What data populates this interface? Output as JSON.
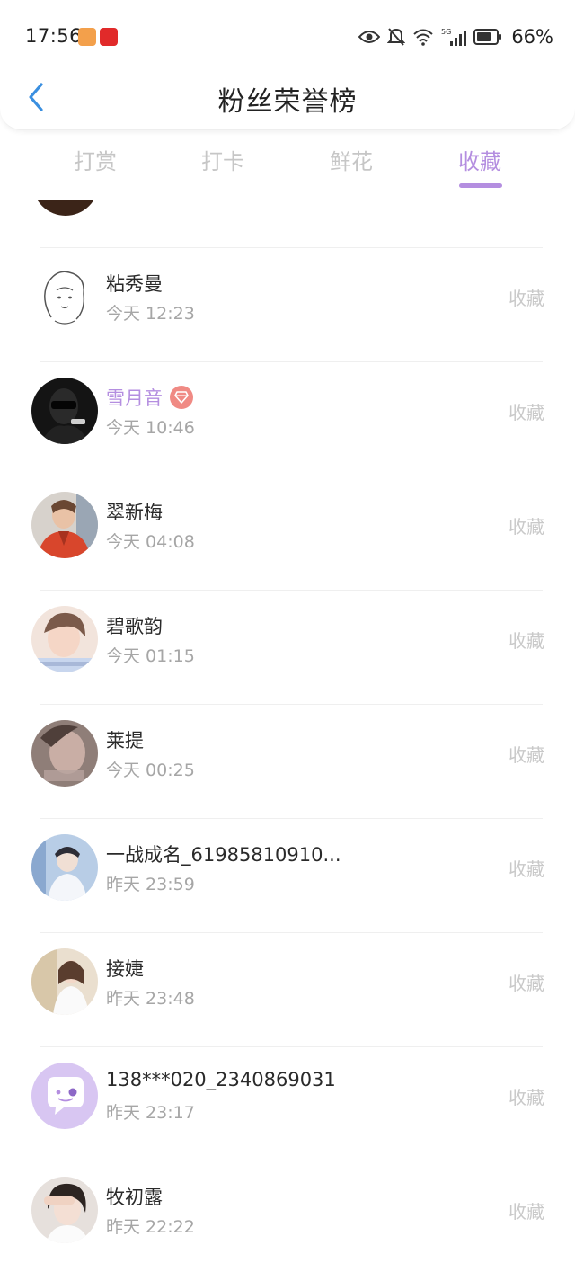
{
  "status_bar": {
    "time": "17:56",
    "battery": "66%",
    "icons": [
      "eye-icon",
      "bell-muted-icon",
      "wifi-icon",
      "5g-signal-icon",
      "battery-icon"
    ]
  },
  "header": {
    "title": "粉丝荣誉榜",
    "back_icon": "chevron-left-icon"
  },
  "tabs": [
    {
      "label": "打赏",
      "active": false
    },
    {
      "label": "打卡",
      "active": false
    },
    {
      "label": "鲜花",
      "active": false
    },
    {
      "label": "收藏",
      "active": true
    }
  ],
  "colors": {
    "accent": "#b48ee0",
    "muted": "#c6c6c6",
    "badge": "#f08a84"
  },
  "rows": [
    {
      "name": "粘秀曼",
      "time": "今天 12:23",
      "action": "收藏",
      "vip": false,
      "avatar": "sketch-girl-avatar"
    },
    {
      "name": "雪月音",
      "time": "今天 10:46",
      "action": "收藏",
      "vip": true,
      "avatar": "dark-masked-avatar"
    },
    {
      "name": "翠新梅",
      "time": "今天 04:08",
      "action": "收藏",
      "vip": false,
      "avatar": "red-jacket-avatar"
    },
    {
      "name": "碧歌韵",
      "time": "今天 01:15",
      "action": "收藏",
      "vip": false,
      "avatar": "portrait-avatar"
    },
    {
      "name": "莱提",
      "time": "今天 00:25",
      "action": "收藏",
      "vip": false,
      "avatar": "blurred-face-avatar"
    },
    {
      "name": "一战成名_61985810910...",
      "time": "昨天 23:59",
      "action": "收藏",
      "vip": false,
      "avatar": "blue-portrait-avatar"
    },
    {
      "name": "接婕",
      "time": "昨天 23:48",
      "action": "收藏",
      "vip": false,
      "avatar": "girl-white-shirt-avatar"
    },
    {
      "name": "138***020_2340869031",
      "time": "昨天 23:17",
      "action": "收藏",
      "vip": false,
      "avatar": "chat-bubble-avatar"
    },
    {
      "name": "牧初露",
      "time": "昨天 22:22",
      "action": "收藏",
      "vip": false,
      "avatar": "girl-hand-avatar"
    }
  ]
}
